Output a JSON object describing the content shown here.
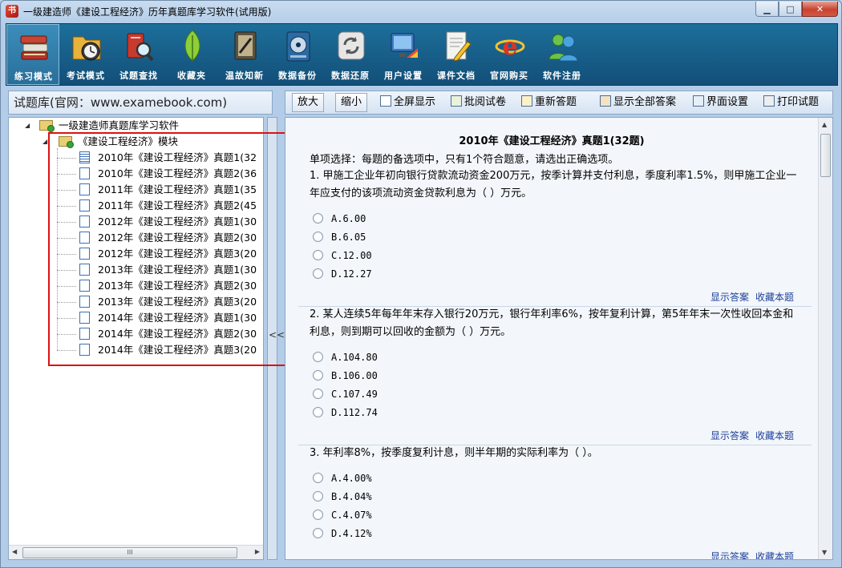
{
  "window": {
    "title": "一级建造师《建设工程经济》历年真题库学习软件(试用版)",
    "minimize": "▁",
    "maximize": "□",
    "close": "✕"
  },
  "toolbar": [
    {
      "label": "练习模式",
      "icon": "books-icon",
      "active": true
    },
    {
      "label": "考试模式",
      "icon": "clock-folder-icon"
    },
    {
      "label": "试题查找",
      "icon": "magnifier-icon"
    },
    {
      "label": "收藏夹",
      "icon": "leaf-icon"
    },
    {
      "label": "温故知新",
      "icon": "notebook-icon"
    },
    {
      "label": "数据备份",
      "icon": "hard-disk-icon"
    },
    {
      "label": "数据还原",
      "icon": "restore-icon"
    },
    {
      "label": "用户设置",
      "icon": "monitor-palette-icon"
    },
    {
      "label": "课件文档",
      "icon": "document-pencil-icon"
    },
    {
      "label": "官网购买",
      "icon": "ie-browser-icon"
    },
    {
      "label": "软件注册",
      "icon": "users-icon"
    }
  ],
  "library": {
    "title": "试题库(官网：www.examebook.com)",
    "root": "一级建造师真题库学习软件",
    "module": "《建设工程经济》模块",
    "papers": [
      "2010年《建设工程经济》真题1(32",
      "2010年《建设工程经济》真题2(36",
      "2011年《建设工程经济》真题1(35",
      "2011年《建设工程经济》真题2(45",
      "2012年《建设工程经济》真题1(30",
      "2012年《建设工程经济》真题2(30",
      "2012年《建设工程经济》真题3(20",
      "2013年《建设工程经济》真题1(30",
      "2013年《建设工程经济》真题2(30",
      "2013年《建设工程经济》真题3(20",
      "2014年《建设工程经济》真题1(30",
      "2014年《建设工程经济》真题2(30",
      "2014年《建设工程经济》真题3(20"
    ],
    "scroll_thumb": "III",
    "collapse": "<<"
  },
  "actions": [
    {
      "label": "放大"
    },
    {
      "label": "缩小"
    },
    {
      "label": "全屏显示"
    },
    {
      "label": "批阅试卷"
    },
    {
      "label": "重新答题"
    },
    {
      "label": "显示全部答案"
    },
    {
      "label": "界面设置"
    },
    {
      "label": "打印试题"
    }
  ],
  "exam": {
    "title": "2010年《建设工程经济》真题1(32题)",
    "section": "单项选择：每题的备选项中，只有1个符合题意，请选出正确选项。",
    "show_answer": "显示答案",
    "favorite": "收藏本题",
    "questions": [
      {
        "text": "1. 甲施工企业年初向银行贷款流动资金200万元，按季计算并支付利息，季度利率1.5%，则甲施工企业一年应支付的该项流动资金贷款利息为（ ）万元。",
        "options": [
          "A.6.00",
          "B.6.05",
          "C.12.00",
          "D.12.27"
        ]
      },
      {
        "text": "2. 某人连续5年每年年末存入银行20万元，银行年利率6%，按年复利计算，第5年年末一次性收回本金和利息，则到期可以回收的金额为（ ）万元。",
        "options": [
          "A.104.80",
          "B.106.00",
          "C.107.49",
          "D.112.74"
        ]
      },
      {
        "text": "3. 年利率8%，按季度复利计息，则半年期的实际利率为（ ）。",
        "options": [
          "A.4.00%",
          "B.4.04%",
          "C.4.07%",
          "D.4.12%"
        ]
      }
    ]
  }
}
